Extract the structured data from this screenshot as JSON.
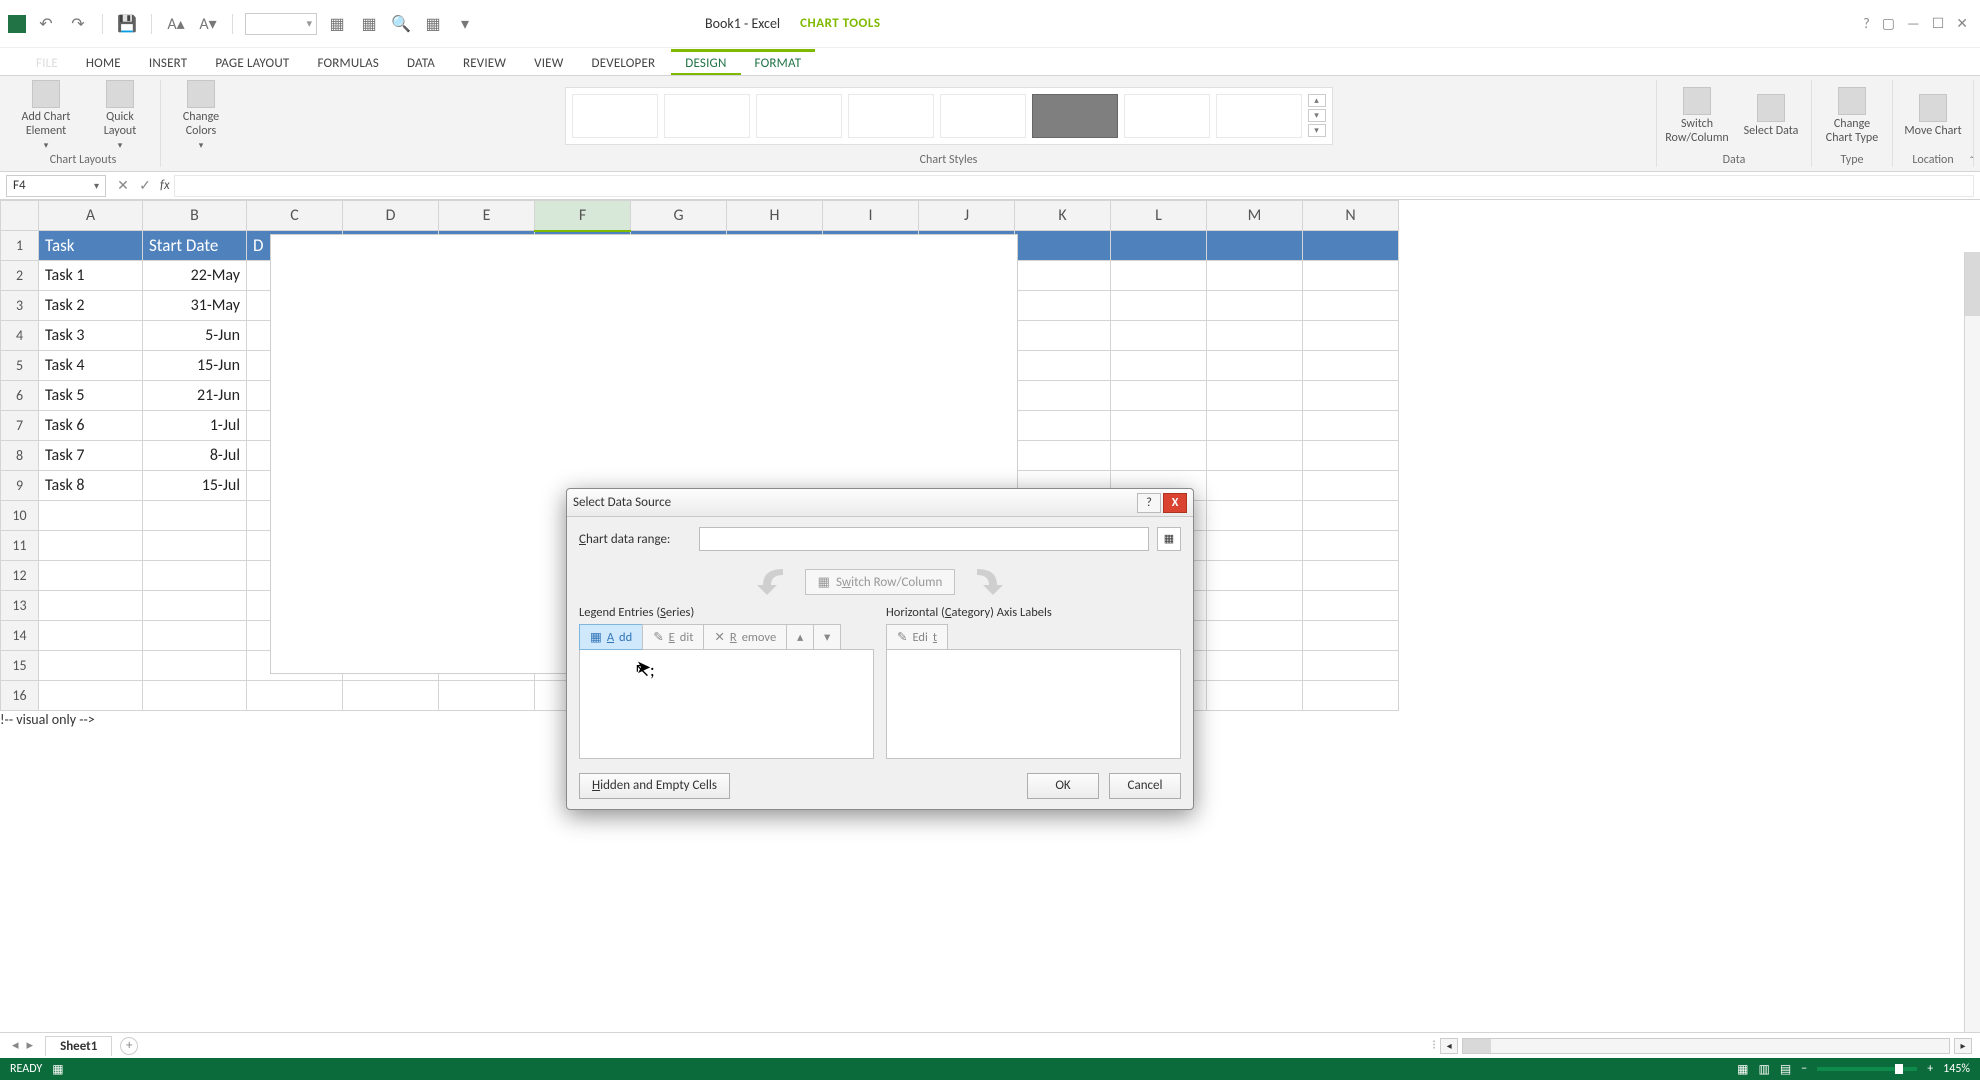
{
  "title": "Book1 - Excel",
  "chart_tools_label": "CHART TOOLS",
  "tabs": {
    "file": "FILE",
    "home": "HOME",
    "insert": "INSERT",
    "pagelayout": "PAGE LAYOUT",
    "formulas": "FORMULAS",
    "data": "DATA",
    "review": "REVIEW",
    "view": "VIEW",
    "developer": "DEVELOPER",
    "design": "DESIGN",
    "format": "FORMAT"
  },
  "ribbon": {
    "chart_layouts": "Chart Layouts",
    "chart_styles": "Chart Styles",
    "data": "Data",
    "type": "Type",
    "location": "Location",
    "add_chart_element": "Add Chart Element",
    "quick_layout": "Quick Layout",
    "change_colors": "Change Colors",
    "switch_row_col": "Switch Row/Column",
    "select_data": "Select Data",
    "change_chart_type": "Change Chart Type",
    "move_chart": "Move Chart"
  },
  "namebox": "F4",
  "columns": [
    "A",
    "B",
    "C",
    "D",
    "E",
    "F",
    "G",
    "H",
    "I",
    "J",
    "K",
    "L",
    "M",
    "N"
  ],
  "rows": [
    1,
    2,
    3,
    4,
    5,
    6,
    7,
    8,
    9,
    10,
    11,
    12,
    13,
    14,
    15,
    16
  ],
  "headers": {
    "a": "Task",
    "b": "Start Date",
    "c": "D"
  },
  "tdata": [
    {
      "task": "Task 1",
      "date": "22-May"
    },
    {
      "task": "Task 2",
      "date": "31-May"
    },
    {
      "task": "Task 3",
      "date": "5-Jun"
    },
    {
      "task": "Task 4",
      "date": "15-Jun"
    },
    {
      "task": "Task 5",
      "date": "21-Jun"
    },
    {
      "task": "Task 6",
      "date": "1-Jul"
    },
    {
      "task": "Task 7",
      "date": "8-Jul"
    },
    {
      "task": "Task 8",
      "date": "15-Jul"
    }
  ],
  "dialog": {
    "title": "Select Data Source",
    "chart_data_range": "Chart data range:",
    "switch": "Switch Row/Column",
    "legend_entries": "Legend Entries (Series)",
    "axis_labels": "Horizontal (Category) Axis Labels",
    "add": "Add",
    "edit": "Edit",
    "remove": "Remove",
    "edit2": "Edit",
    "hidden": "Hidden and Empty Cells",
    "ok": "OK",
    "cancel": "Cancel"
  },
  "sheet_tab": "Sheet1",
  "status": {
    "ready": "READY",
    "zoom": "145%"
  }
}
